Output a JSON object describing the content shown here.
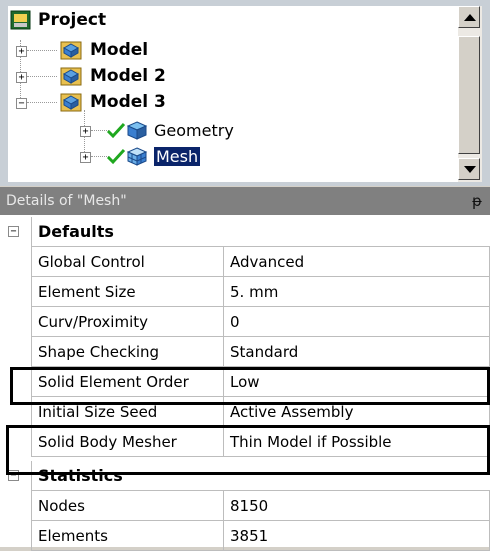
{
  "tree": {
    "project_label": "Project",
    "models": [
      {
        "label": "Model"
      },
      {
        "label": "Model 2"
      },
      {
        "label": "Model 3"
      }
    ],
    "children": [
      {
        "label": "Geometry"
      },
      {
        "label": "Mesh"
      }
    ]
  },
  "details": {
    "title": "Details of \"Mesh\"",
    "pin_symbol": "ᵽ",
    "sections": [
      {
        "label": "Defaults",
        "rows": [
          {
            "name": "Global Control",
            "value": "Advanced"
          },
          {
            "name": "Element Size",
            "value": "5. mm"
          },
          {
            "name": "Curv/Proximity",
            "value": "0"
          },
          {
            "name": "Shape Checking",
            "value": "Standard"
          },
          {
            "name": "Solid Element Order",
            "value": "Low"
          },
          {
            "name": "Initial Size Seed",
            "value": "Active Assembly"
          },
          {
            "name": "Solid Body Mesher",
            "value": "Thin Model if Possible"
          }
        ]
      },
      {
        "label": "Statistics",
        "rows": [
          {
            "name": "Nodes",
            "value": "8150"
          },
          {
            "name": "Elements",
            "value": "3851"
          }
        ]
      }
    ]
  },
  "colors": {
    "selection": "#0a246a",
    "header_bg": "#808080",
    "model_icon": "#e0b040",
    "mesh_icon": "#3a7fd0",
    "check": "#1fa81f"
  }
}
